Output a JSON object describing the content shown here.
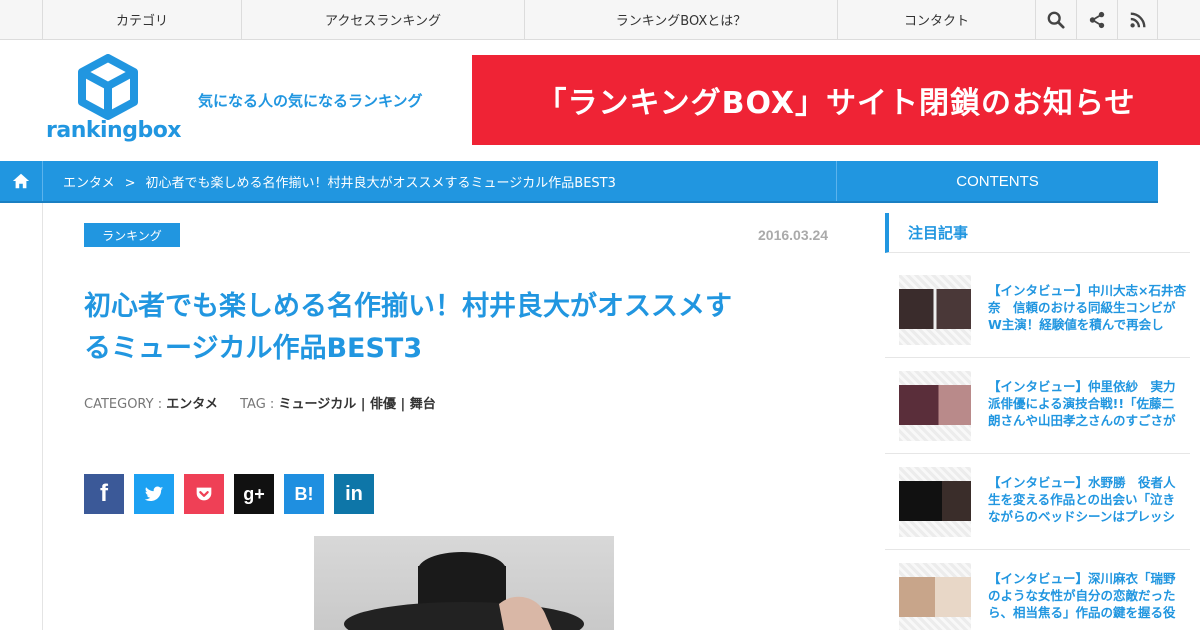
{
  "topnav": {
    "items": [
      "カテゴリ",
      "アクセスランキング",
      "ランキングBOXとは？",
      "コンタクト"
    ]
  },
  "header": {
    "logo_text": "rankingbox",
    "tagline": "気になる人の気になるランキング",
    "banner": "「ランキングBOX」サイト閉鎖のお知らせ"
  },
  "breadcrumb": {
    "section": "エンタメ",
    "separator": ">",
    "current": "初心者でも楽しめる名作揃い！村井良大がオススメするミュージカル作品BEST3",
    "contents_tab": "CONTENTS"
  },
  "article": {
    "category_badge": "ランキング",
    "date": "2016.03.24",
    "title_line1": "初心者でも楽しめる名作揃い！村井良大がオススメす",
    "title_line2": "るミュージカル作品BEST3",
    "category_label": "CATEGORY :",
    "category_value": "エンタメ",
    "tag_label": "TAG :",
    "tags": "ミュージカル | 俳優 | 舞台"
  },
  "share": [
    {
      "label": "f",
      "icon": "facebook-icon",
      "color": "#3b5998"
    },
    {
      "label": "t",
      "icon": "twitter-icon",
      "color": "#1da1f2"
    },
    {
      "label": "p",
      "icon": "pocket-icon",
      "color": "#ef4056"
    },
    {
      "label": "g+",
      "icon": "google-plus-icon",
      "color": "#111111"
    },
    {
      "label": "B!",
      "icon": "hatena-icon",
      "color": "#1f8fe0"
    },
    {
      "label": "in",
      "icon": "linkedin-icon",
      "color": "#0e76a8"
    }
  ],
  "sidebar": {
    "heading": "注目記事",
    "items": [
      {
        "text": "【インタビュー】中川大志×石井杏奈　信頼のおける同級生コンビがW主演！経験値を積んで再会し"
      },
      {
        "text": "【インタビュー】仲里依紗　実力派俳優による演技合戦!!「佐藤二朗さんや山田孝之さんのすごさが"
      },
      {
        "text": "【インタビュー】水野勝　役者人生を変える作品との出会い「泣きながらのベッドシーンはプレッシ"
      },
      {
        "text": "【インタビュー】深川麻衣「瑞野のような女性が自分の恋敵だったら、相当焦る」作品の鍵を握る役"
      }
    ]
  },
  "colors": {
    "accent": "#2196e0",
    "banner": "#ef2335"
  }
}
